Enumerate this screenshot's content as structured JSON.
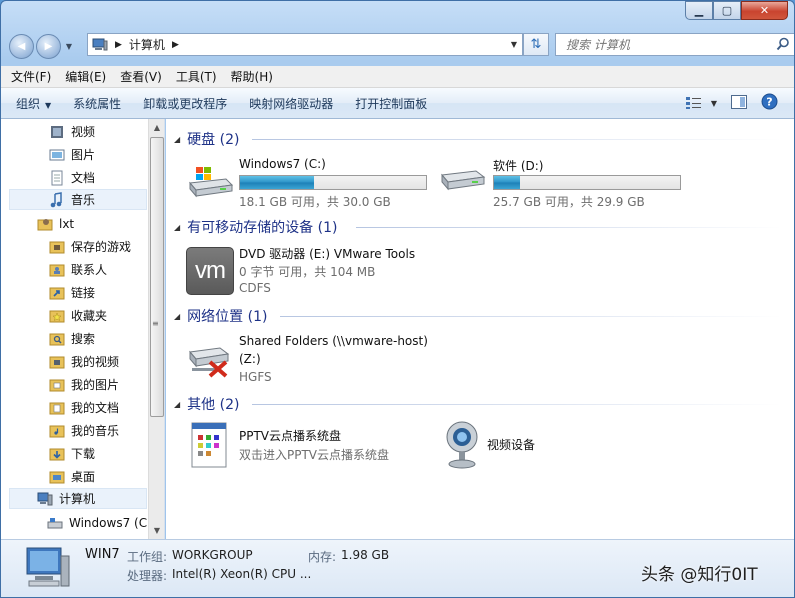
{
  "nav": {
    "back": "◀",
    "forward": "▶",
    "address_crumb": "计算机",
    "search_placeholder": "搜索 计算机"
  },
  "menubar": [
    {
      "label": "文件(F)"
    },
    {
      "label": "编辑(E)"
    },
    {
      "label": "查看(V)"
    },
    {
      "label": "工具(T)"
    },
    {
      "label": "帮助(H)"
    }
  ],
  "commands": {
    "organize": "组织",
    "system_props": "系统属性",
    "uninstall": "卸载或更改程序",
    "map_drive": "映射网络驱动器",
    "control_panel": "打开控制面板"
  },
  "sidebar": {
    "items": [
      {
        "label": "视频",
        "icon": "video-library-icon"
      },
      {
        "label": "图片",
        "icon": "pictures-library-icon"
      },
      {
        "label": "文档",
        "icon": "documents-library-icon"
      },
      {
        "label": "音乐",
        "icon": "music-library-icon"
      },
      {
        "label": "lxt",
        "icon": "user-folder-icon"
      },
      {
        "label": "保存的游戏",
        "icon": "saved-games-folder-icon"
      },
      {
        "label": "联系人",
        "icon": "contacts-folder-icon"
      },
      {
        "label": "链接",
        "icon": "links-folder-icon"
      },
      {
        "label": "收藏夹",
        "icon": "favorites-folder-icon"
      },
      {
        "label": "搜索",
        "icon": "searches-folder-icon"
      },
      {
        "label": "我的视频",
        "icon": "my-videos-folder-icon"
      },
      {
        "label": "我的图片",
        "icon": "my-pictures-folder-icon"
      },
      {
        "label": "我的文档",
        "icon": "my-documents-folder-icon"
      },
      {
        "label": "我的音乐",
        "icon": "my-music-folder-icon"
      },
      {
        "label": "下载",
        "icon": "downloads-folder-icon"
      },
      {
        "label": "桌面",
        "icon": "desktop-folder-icon"
      },
      {
        "label": "计算机",
        "icon": "computer-icon"
      },
      {
        "label": "Windows7 (C:",
        "icon": "drive-c-icon"
      }
    ]
  },
  "groups": {
    "hdd": {
      "title": "硬盘 (2)"
    },
    "removable": {
      "title": "有可移动存储的设备 (1)"
    },
    "network": {
      "title": "网络位置 (1)"
    },
    "other": {
      "title": "其他 (2)"
    }
  },
  "drives": {
    "c": {
      "name": "Windows7 (C:)",
      "space": "18.1 GB 可用，共 30.0 GB",
      "used_fraction": 0.397
    },
    "d": {
      "name": "软件 (D:)",
      "space": "25.7 GB 可用，共 29.9 GB",
      "used_fraction": 0.14
    },
    "dvd": {
      "name": "DVD 驱动器 (E:) VMware Tools",
      "space": "0 字节 可用，共 104 MB",
      "fs": "CDFS",
      "logo": "vm"
    },
    "share": {
      "name_line1": "Shared Folders (\\\\vmware-host)",
      "name_line2": "(Z:)",
      "fs": "HGFS"
    },
    "pptv": {
      "name": "PPTV云点播系统盘",
      "desc": "双击进入PPTV云点播系统盘"
    },
    "camera": {
      "name": "视频设备"
    }
  },
  "details": {
    "computer_name": "WIN7",
    "workgroup_label": "工作组:",
    "workgroup_value": "WORKGROUP",
    "memory_label": "内存:",
    "memory_value": "1.98 GB",
    "cpu_label": "处理器:",
    "cpu_value": "Intel(R) Xeon(R) CPU ..."
  },
  "watermark": "头条 @知行0IT",
  "colors": {
    "accent": "#1e3287",
    "progress": "#2b92c8",
    "close_button": "#c9442f"
  }
}
